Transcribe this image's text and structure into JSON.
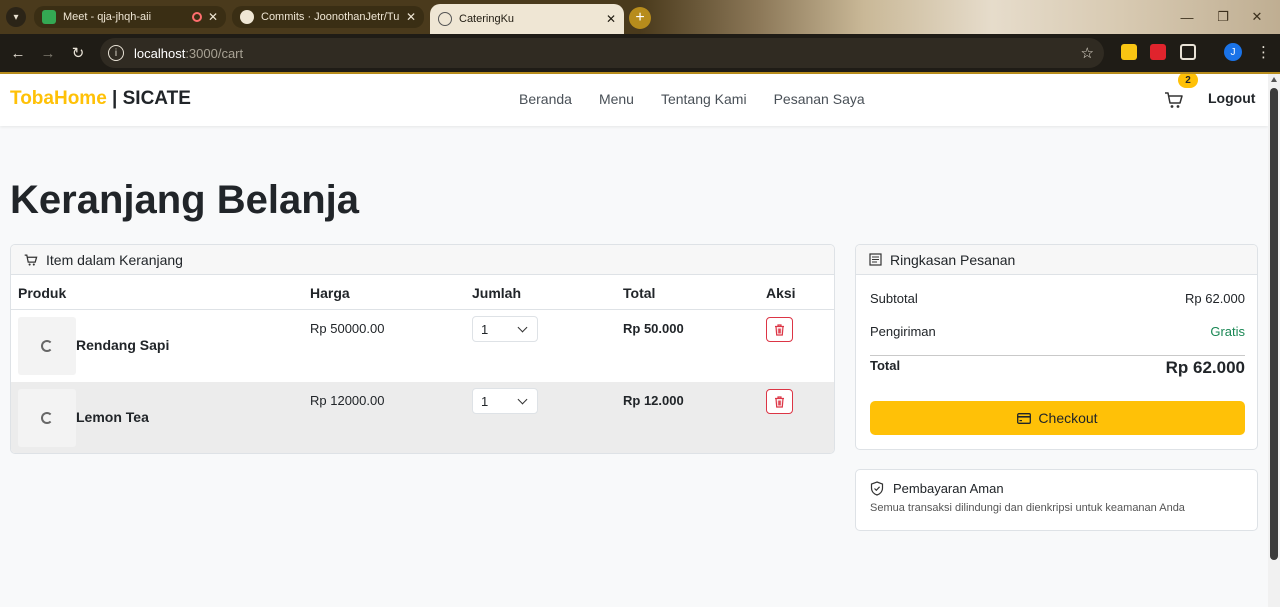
{
  "browser": {
    "tabs": [
      {
        "title": "Meet - qja-jhqh-aii",
        "icon": "meet-icon",
        "active": false
      },
      {
        "title": "Commits · JoonothanJetr/Tubes",
        "icon": "github-icon",
        "active": false
      },
      {
        "title": "CateringKu",
        "icon": "globe-icon",
        "active": true
      }
    ],
    "url_host": "localhost",
    "url_path": ":3000/cart",
    "profile_initial": "J"
  },
  "navbar": {
    "brand_highlight": "TobaHome",
    "brand_rest": " | SICATE",
    "links": [
      "Beranda",
      "Menu",
      "Tentang Kami",
      "Pesanan Saya"
    ],
    "cart_count": "2",
    "logout": "Logout"
  },
  "page": {
    "title": "Keranjang Belanja"
  },
  "cart": {
    "header": "Item dalam Keranjang",
    "columns": [
      "Produk",
      "Harga",
      "Jumlah",
      "Total",
      "Aksi"
    ],
    "items": [
      {
        "name": "Rendang Sapi",
        "price": "Rp 50000.00",
        "qty": "1",
        "total": "Rp 50.000"
      },
      {
        "name": "Lemon Tea",
        "price": "Rp 12000.00",
        "qty": "1",
        "total": "Rp 12.000"
      }
    ]
  },
  "summary": {
    "header": "Ringkasan Pesanan",
    "subtotal_label": "Subtotal",
    "subtotal_value": "Rp 62.000",
    "shipping_label": "Pengiriman",
    "shipping_value": "Gratis",
    "total_label": "Total",
    "total_value": "Rp 62.000",
    "checkout_label": "Checkout"
  },
  "secure": {
    "title": "Pembayaran Aman",
    "description": "Semua transaksi dilindungi dan dienkripsi untuk keamanan Anda"
  },
  "colors": {
    "accent": "#ffc107",
    "danger": "#dc3545",
    "success": "#198754"
  }
}
